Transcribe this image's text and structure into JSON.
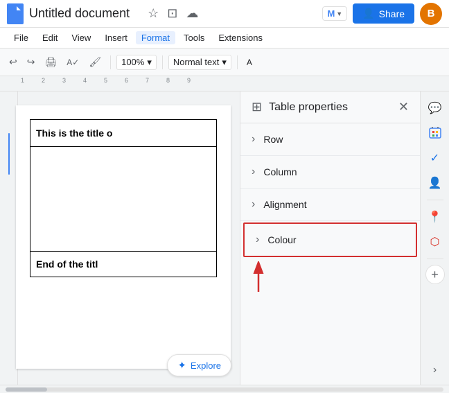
{
  "topbar": {
    "doc_title": "Untitled document",
    "share_label": "Share",
    "avatar_letter": "B"
  },
  "menubar": {
    "items": [
      "File",
      "Edit",
      "View",
      "Insert",
      "Format",
      "Tools",
      "Extensions"
    ]
  },
  "toolbar": {
    "zoom": "100%",
    "style": "Normal text",
    "undo_icon": "↩",
    "redo_icon": "↪",
    "print_icon": "🖨",
    "paint_icon": "⟗",
    "cursor_icon": "↖"
  },
  "panel": {
    "title": "Table properties",
    "sections": [
      {
        "label": "Row"
      },
      {
        "label": "Column"
      },
      {
        "label": "Alignment"
      },
      {
        "label": "Colour",
        "highlighted": true
      }
    ]
  },
  "doc": {
    "title_text": "This is the title o",
    "end_text": "End of the titl"
  },
  "explore": {
    "label": "Explore"
  },
  "right_sidebar": {
    "icons": [
      "📅",
      "🟡",
      "✅",
      "👤",
      "📍",
      "🔴",
      "➕"
    ]
  }
}
